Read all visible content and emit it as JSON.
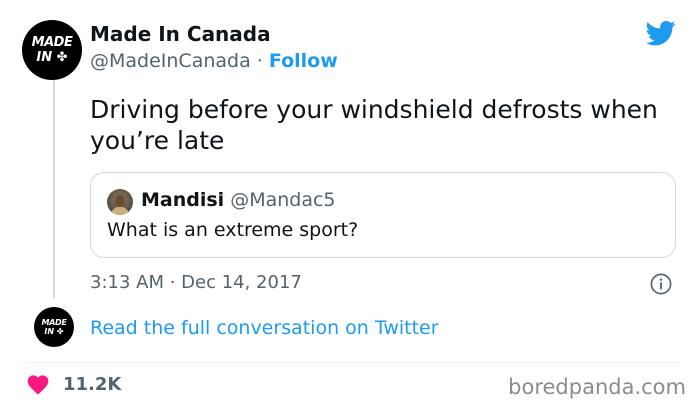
{
  "author": {
    "avatar_line1": "MADE",
    "avatar_line2": "IN",
    "avatar_symbol": "✤",
    "name": "Made In Canada",
    "handle": "@MadeInCanada",
    "separator": "·",
    "follow_label": "Follow"
  },
  "tweet": {
    "text": "Driving before your windshield defrosts when you’re late",
    "timestamp": "3:13 AM · Dec 14, 2017"
  },
  "quoted_tweet": {
    "name": "Mandisi",
    "handle": "@Mandac5",
    "text": "What is an extreme sport?"
  },
  "conversation": {
    "link_text": "Read the full conversation on Twitter"
  },
  "engagement": {
    "like_count": "11.2K"
  },
  "watermark": "boredpanda.com",
  "icons": {
    "brand": "twitter-bird-icon",
    "info": "info-icon",
    "like": "heart-icon"
  },
  "colors": {
    "accent": "#1d9bf0",
    "heart": "#f91880",
    "secondary_text": "#536471",
    "primary_text": "#0f1419",
    "border": "#cfd9de"
  }
}
